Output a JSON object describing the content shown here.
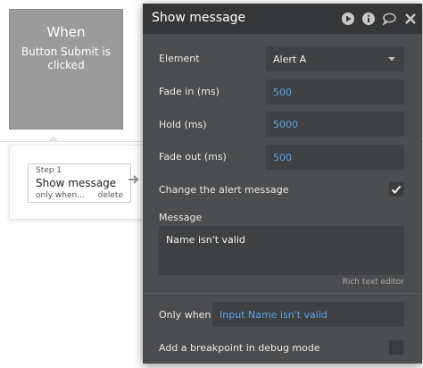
{
  "when": {
    "title": "When",
    "description": "Button Submit is clicked"
  },
  "step": {
    "number": "Step 1",
    "name": "Show message",
    "only_when": "only when...",
    "delete": "delete"
  },
  "panel": {
    "title": "Show message",
    "icons": [
      "play-icon",
      "info-icon",
      "comment-icon",
      "close-icon"
    ],
    "element_label": "Element",
    "element_value": "Alert A",
    "fade_in_label": "Fade in (ms)",
    "fade_in_value": "500",
    "hold_label": "Hold (ms)",
    "hold_value": "5000",
    "fade_out_label": "Fade out (ms)",
    "fade_out_value": "500",
    "change_alert_label": "Change the alert message",
    "change_alert_checked": true,
    "message_label": "Message",
    "message_value": "Name isn't valid",
    "rich_text_link": "Rich text editor",
    "only_when_label": "Only when",
    "only_when_value": "Input Name isn't valid",
    "breakpoint_label": "Add a breakpoint in debug mode",
    "breakpoint_checked": false
  },
  "colors": {
    "panel_bg": "#4b4d4f",
    "header_bg": "#353638",
    "field_bg": "#3f4143",
    "accent_blue": "#5aa0e6",
    "when_card": "#9b9b9b"
  }
}
